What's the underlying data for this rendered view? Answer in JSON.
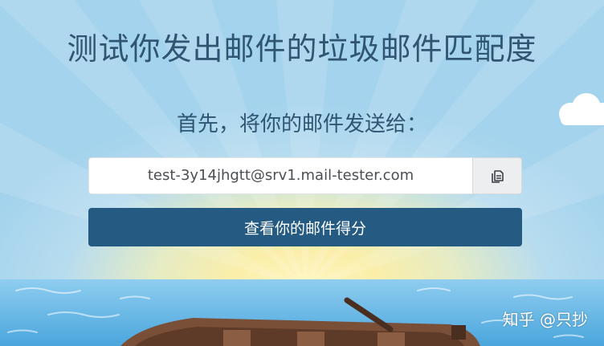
{
  "header": {
    "title": "测试你发出邮件的垃圾邮件匹配度"
  },
  "prompt": {
    "text": "首先，将你的邮件发送给："
  },
  "address": {
    "value": "test-3y14jhgtt@srv1.mail-tester.com",
    "copy_icon": "copy-icon"
  },
  "actions": {
    "check_label": "查看你的邮件得分"
  },
  "watermark": {
    "text": "知乎 @只抄"
  },
  "colors": {
    "title": "#2f5572",
    "button": "#255b82",
    "sky": "#a9d8ee",
    "sea": "#62b3e3",
    "boat": "#7a4f38"
  }
}
